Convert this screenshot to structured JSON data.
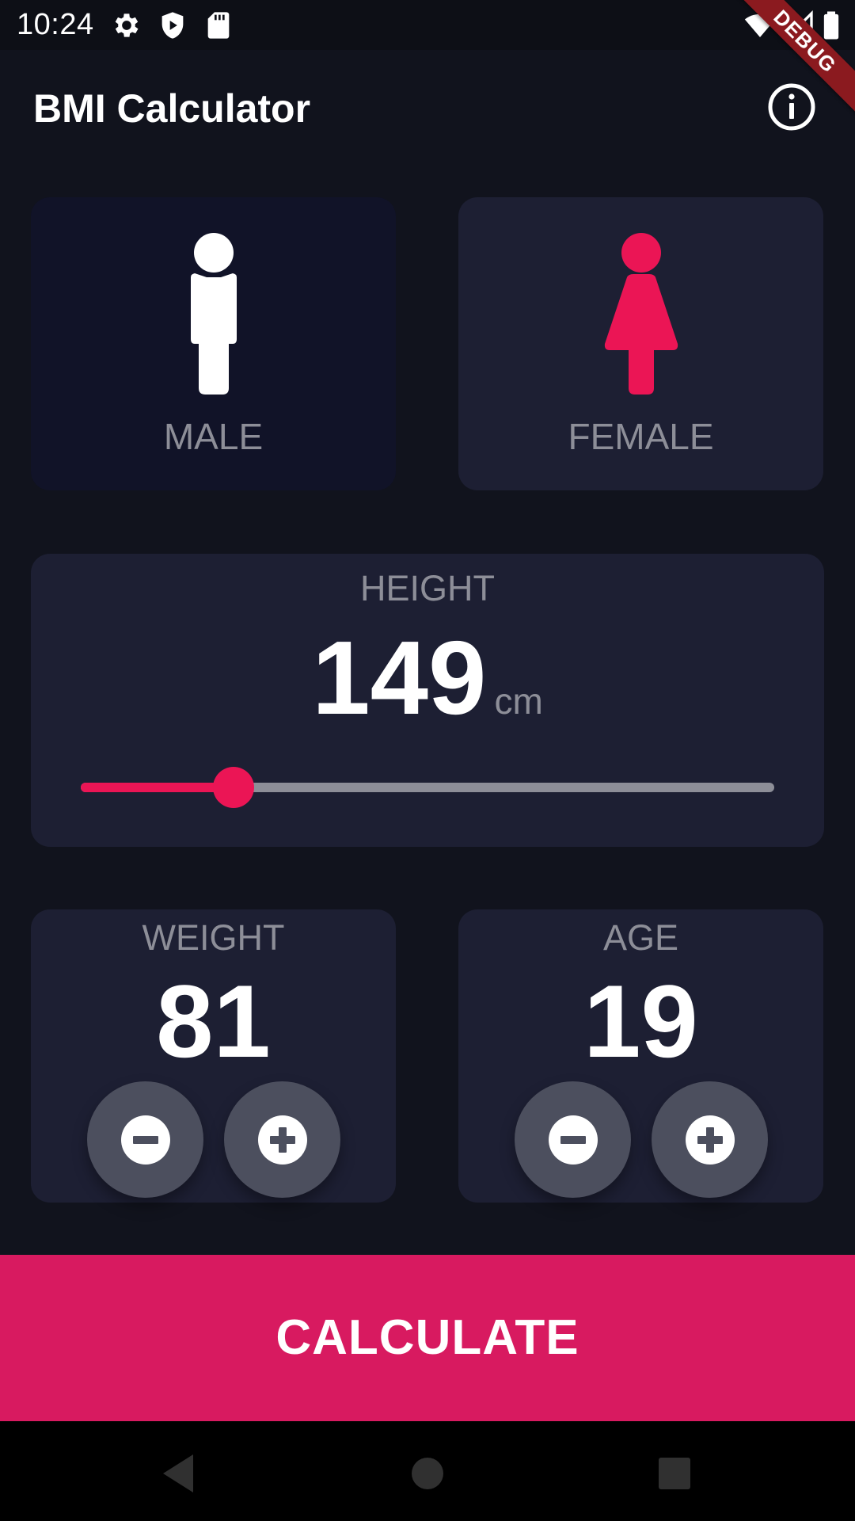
{
  "status_bar": {
    "time": "10:24",
    "icons": [
      "gear-icon",
      "shield-icon",
      "sd-card-icon",
      "wifi-icon",
      "signal-icon",
      "battery-icon"
    ]
  },
  "debug_banner": "DEBUG",
  "app_bar": {
    "title": "BMI Calculator",
    "action_icon": "info-icon"
  },
  "gender": {
    "selected": "male",
    "male_label": "MALE",
    "female_label": "FEMALE"
  },
  "height": {
    "label": "HEIGHT",
    "value": "149",
    "unit": "cm",
    "slider_fraction": 0.22
  },
  "weight": {
    "label": "WEIGHT",
    "value": "81"
  },
  "age": {
    "label": "AGE",
    "value": "19"
  },
  "calculate_label": "CALCULATE",
  "colors": {
    "background": "#11131d",
    "card": "#1d1f33",
    "card_selected": "#111328",
    "accent": "#eb1555",
    "calculate_bg": "#d81a60",
    "label_grey": "#8d8e98",
    "round_button": "#4c4f5e"
  },
  "nav_bar": {
    "icons": [
      "back-icon",
      "home-icon",
      "recents-icon"
    ]
  }
}
